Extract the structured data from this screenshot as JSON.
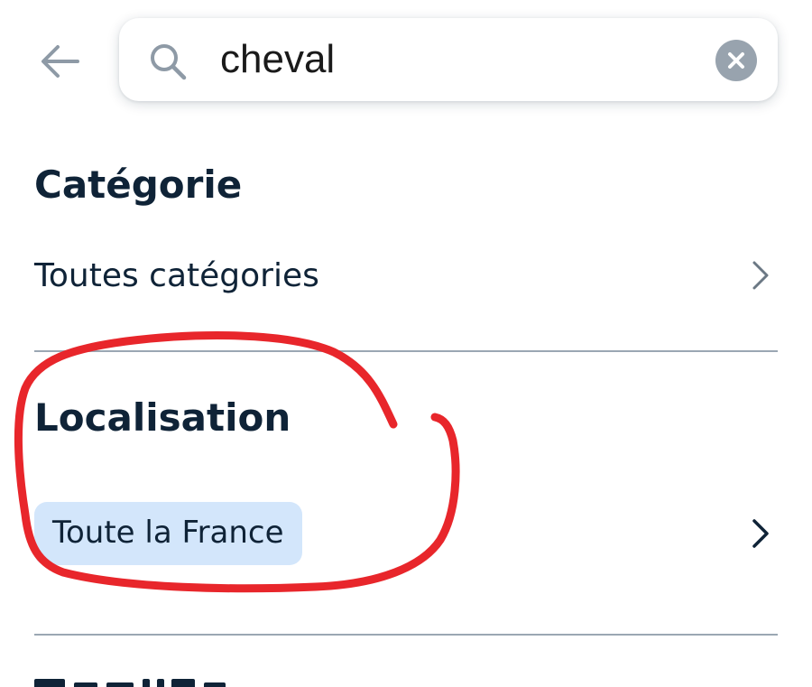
{
  "search": {
    "value": "cheval",
    "placeholder": ""
  },
  "sections": {
    "category": {
      "title": "Catégorie",
      "value": "Toutes catégories"
    },
    "location": {
      "title": "Localisation",
      "value": "Toute la France"
    }
  },
  "icons": {
    "back": "arrow-left-icon",
    "search": "search-icon",
    "clear": "clear-icon",
    "chevron": "chevron-right-icon"
  },
  "colors": {
    "text": "#0f2337",
    "chip_bg": "#d3e6fb",
    "annotation": "#e8262b",
    "divider": "#9ba7b3"
  }
}
